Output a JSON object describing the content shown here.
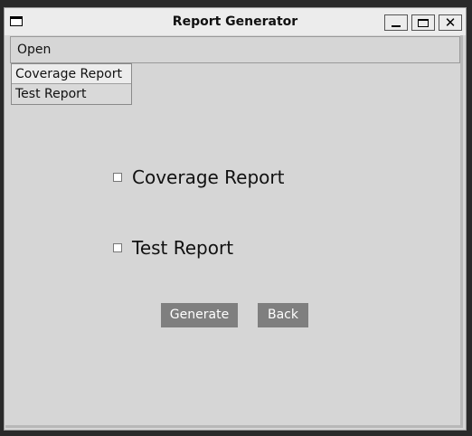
{
  "window": {
    "title": "Report Generator",
    "controls": {
      "minimize": "minimize-icon",
      "maximize": "maximize-icon",
      "close": "close-icon"
    }
  },
  "menubar": {
    "open_label": "Open"
  },
  "dropdown": {
    "items": [
      {
        "label": "Coverage Report"
      },
      {
        "label": "Test Report"
      }
    ]
  },
  "options": [
    {
      "label": "Coverage Report",
      "checked": false
    },
    {
      "label": "Test Report",
      "checked": false
    }
  ],
  "buttons": {
    "generate_label": "Generate",
    "back_label": "Back"
  },
  "colors": {
    "window_bg": "#d6d6d6",
    "button_bg": "#7f7f7f",
    "button_text": "#ffffff"
  }
}
